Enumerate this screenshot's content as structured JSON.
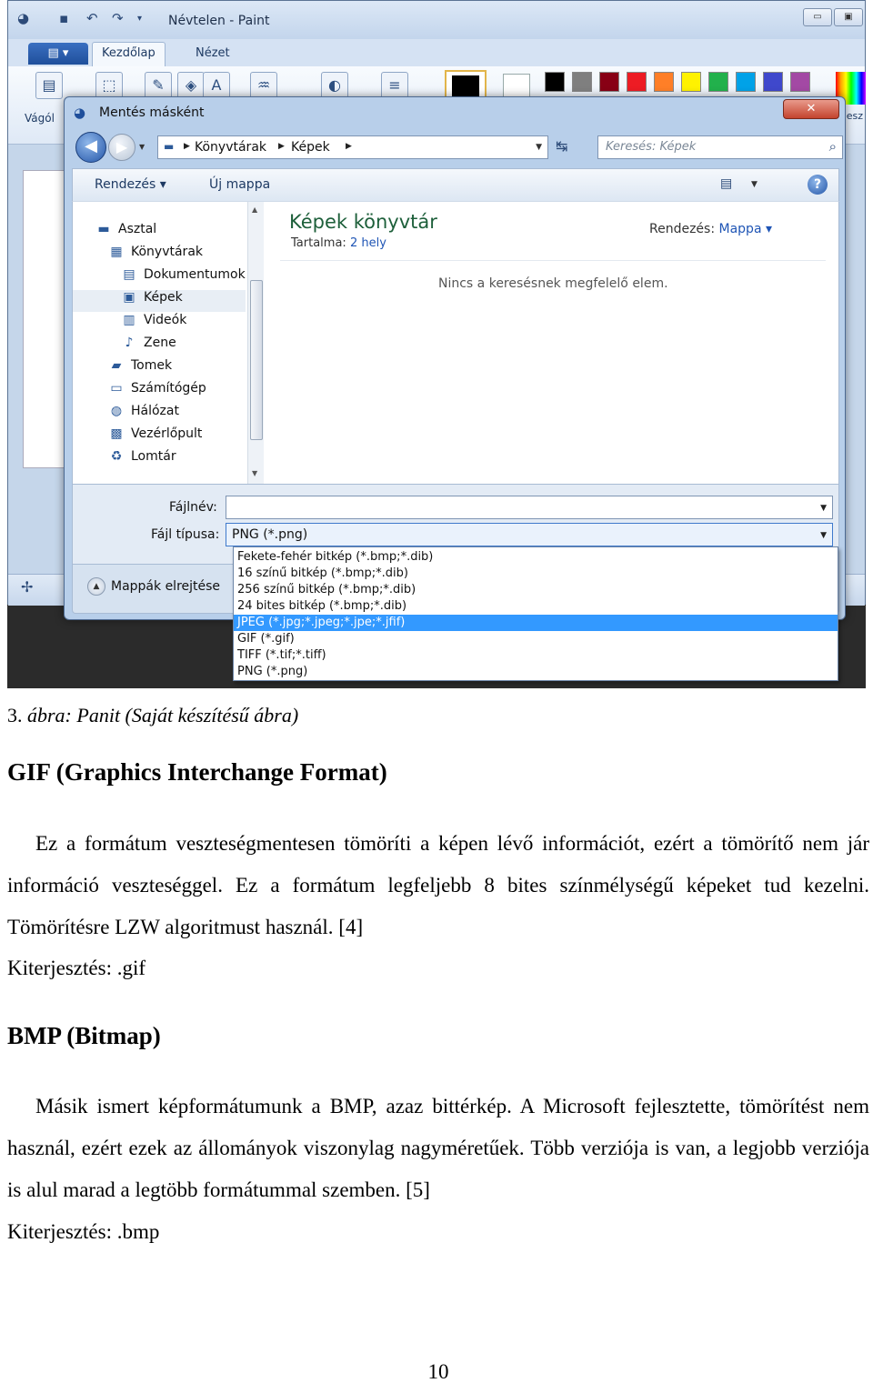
{
  "paint": {
    "title": "Névtelen - Paint",
    "file_menu": "▤ ▾",
    "tabs": [
      "Kezdőlap",
      "Nézet"
    ],
    "clipboard_label": "Vágól",
    "colors_label": "ine esz",
    "palette": [
      "#000000",
      "#7f7f7f",
      "#880015",
      "#ed1c24",
      "#ff7f27",
      "#fff200",
      "#22b14c",
      "#00a2e8",
      "#3f48cc",
      "#a349a4"
    ]
  },
  "dialog": {
    "title": "Mentés másként",
    "close": "✕",
    "breadcrumb": [
      "Könyvtárak",
      "Képek"
    ],
    "search_placeholder": "Keresés: Képek",
    "toolbar": {
      "organize": "Rendezés ▾",
      "new_folder": "Új mappa"
    },
    "nav_items": [
      {
        "label": "Asztal",
        "icon": "desktop-icon",
        "glyph": "▬"
      },
      {
        "label": "Könyvtárak",
        "icon": "libraries-icon",
        "glyph": "▦"
      },
      {
        "label": "Dokumentumok",
        "icon": "documents-icon",
        "glyph": "▤"
      },
      {
        "label": "Képek",
        "icon": "pictures-icon",
        "glyph": "▣"
      },
      {
        "label": "Videók",
        "icon": "videos-icon",
        "glyph": "▥"
      },
      {
        "label": "Zene",
        "icon": "music-icon",
        "glyph": "♪"
      },
      {
        "label": "Tomek",
        "icon": "user-folder-icon",
        "glyph": "▰"
      },
      {
        "label": "Számítógép",
        "icon": "computer-icon",
        "glyph": "▭"
      },
      {
        "label": "Hálózat",
        "icon": "network-icon",
        "glyph": "◍"
      },
      {
        "label": "Vezérlőpult",
        "icon": "control-panel-icon",
        "glyph": "▩"
      },
      {
        "label": "Lomtár",
        "icon": "recycle-bin-icon",
        "glyph": "♻"
      }
    ],
    "library_title": "Képek könyvtár",
    "library_contains_label": "Tartalma:",
    "library_contains_value": "2 hely",
    "arrange_label": "Rendezés:",
    "arrange_value": "Mappa ▾",
    "empty_message": "Nincs a keresésnek megfelelő elem.",
    "filename_label": "Fájlnév:",
    "filename_value": "",
    "filetype_label": "Fájl típusa:",
    "filetype_value": "PNG (*.png)",
    "filetype_options": [
      "Fekete-fehér bitkép (*.bmp;*.dib)",
      "16 színű bitkép (*.bmp;*.dib)",
      "256 színű bitkép (*.bmp;*.dib)",
      "24 bites bitkép (*.bmp;*.dib)",
      "JPEG (*.jpg;*.jpeg;*.jpe;*.jfif)",
      "GIF (*.gif)",
      "TIFF (*.tif;*.tiff)",
      "PNG (*.png)"
    ],
    "highlighted_option": 4,
    "hide_folders": "Mappák elrejtése"
  },
  "document": {
    "caption_number": "3.",
    "caption_text": "ábra: Panit (Saját készítésű ábra)",
    "gif_heading": "GIF (Graphics Interchange Format)",
    "gif_paragraph": "Ez a formátum veszteségmentesen tömöríti a képen lévő információt, ezért a tömörítő nem jár információ veszteséggel. Ez a formátum legfeljebb 8 bites színmélységű képeket tud kezelni. Tömörítésre LZW algoritmust használ. [4]",
    "gif_extension": "Kiterjesztés: .gif",
    "bmp_heading": "BMP (Bitmap)",
    "bmp_paragraph": "Másik ismert képformátumunk a BMP, azaz bittérkép. A Microsoft fejlesztette, tömörítést nem használ, ezért ezek az állományok viszonylag nagyméretűek. Több verziója is van, a legjobb verziója is alul marad a legtöbb formátummal szemben. [5]",
    "bmp_extension": "Kiterjesztés: .bmp",
    "page_number": "10"
  }
}
